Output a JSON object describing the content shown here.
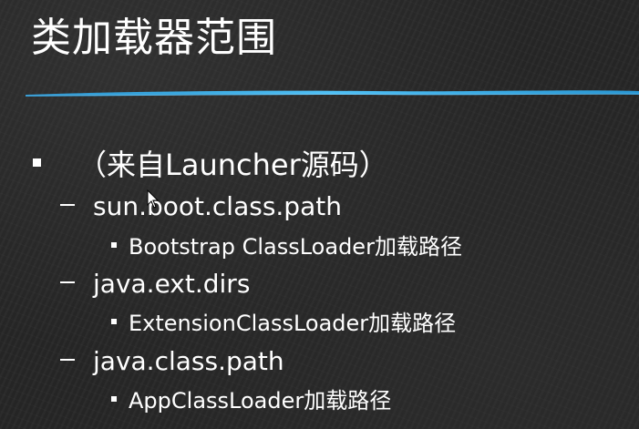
{
  "slide": {
    "title": "类加载器范围",
    "accent_color": "#29a3e6",
    "bullets": {
      "level1": "（来自Launcher源码）",
      "items": [
        {
          "property": "sun.boot.class.path",
          "detail": "Bootstrap ClassLoader加载路径"
        },
        {
          "property": "java.ext.dirs",
          "detail": "ExtensionClassLoader加载路径"
        },
        {
          "property": "java.class.path",
          "detail": "AppClassLoader加载路径"
        }
      ]
    }
  }
}
